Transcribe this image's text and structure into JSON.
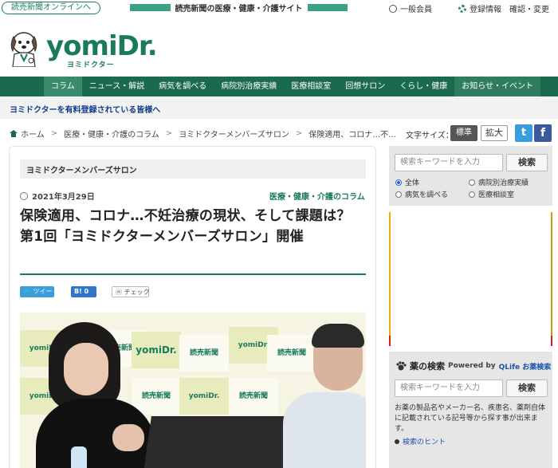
{
  "topbar": {
    "online_label": "読売新聞オンラインへ",
    "tagline": "読売新聞の医療・健康・介護サイト",
    "member": "一般会員",
    "settings": "登録情報　確認・変更"
  },
  "logo": {
    "word": "yomiDr.",
    "sub": "ヨミドクター"
  },
  "nav": {
    "items": [
      "コラム",
      "ニュース・解説",
      "病気を調べる",
      "病院別治療実績",
      "医療相談室",
      "回想サロン",
      "くらし・健康",
      "お知らせ・イベント"
    ]
  },
  "promo": {
    "text": "ヨミドクターを有料登録されている皆様へ"
  },
  "breadcrumb": {
    "items": [
      "ホーム",
      "医療・健康・介護のコラム",
      "ヨミドクターメンバーズサロン",
      "保険適用、コロナ…不..."
    ]
  },
  "textsize": {
    "label": "文字サイズ：",
    "standard": "標準",
    "large": "拡大"
  },
  "social": {
    "twitter": "t",
    "facebook": "f"
  },
  "article": {
    "category_box": "ヨミドクターメンバーズサロン",
    "date": "2021年3月29日",
    "category_link": "医療・健康・介護のコラム",
    "title": "保険適用、コロナ…不妊治療の現状、そして課題は？　第1回「ヨミドクターメンバーズサロン」開催",
    "share_tweet": "ツイート",
    "share_hatena": "B! 0",
    "share_check": "チェック"
  },
  "photo": {
    "tile_texts": [
      "yomiDr.",
      "読売新聞"
    ]
  },
  "sidebar": {
    "search_placeholder": "検索キーワードを入力",
    "search_button": "検索",
    "radios": [
      "全体",
      "病院別治療実績",
      "病気を調べる",
      "医療相談室"
    ],
    "drug_title": "薬の検索",
    "powered_by": "Powered by",
    "qlife": "QLife お薬検索",
    "drug_placeholder": "検索キーワードを入力",
    "drug_button": "検索",
    "drug_desc": "お薬の製品名やメーカー名、疾患名、薬剤自体に記載されている記号等から探す事が出来ます。",
    "hint": "検索のヒント"
  },
  "colors": {
    "brand": "#1a7a5c",
    "nav": "#1a6b4e",
    "link": "#123b8a"
  }
}
